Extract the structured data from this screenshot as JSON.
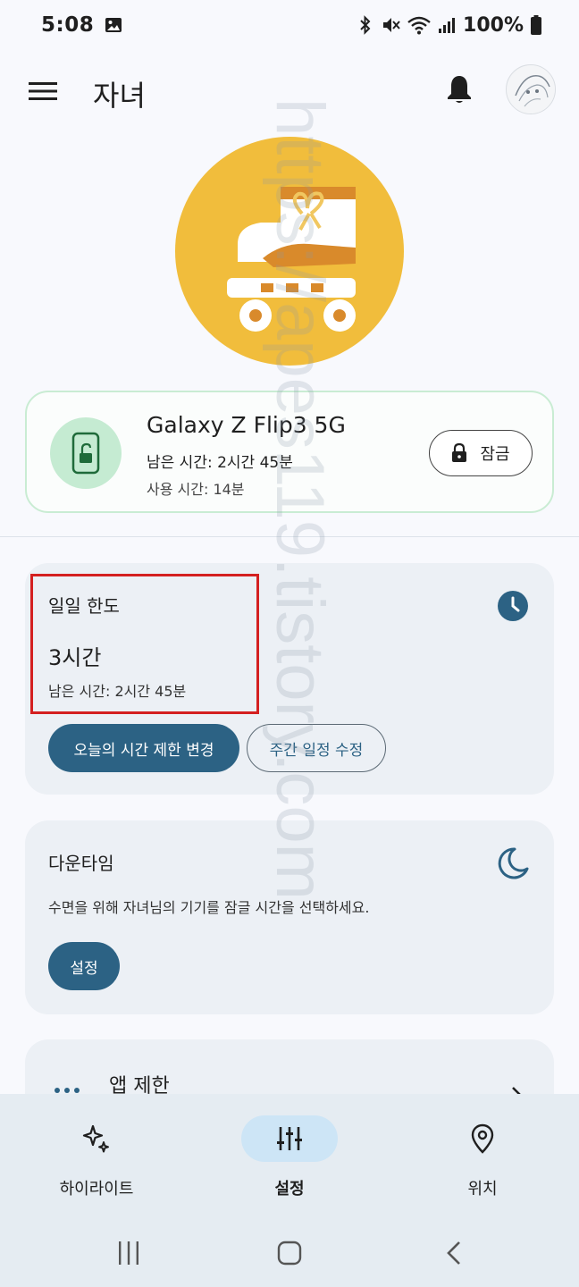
{
  "status_bar": {
    "time": "5:08",
    "battery": "100%"
  },
  "app_bar": {
    "title": "자녀"
  },
  "device": {
    "name": "Galaxy Z Flip3 5G",
    "remaining": "남은 시간: 2시간 45분",
    "used": "사용 시간: 14분",
    "lock_label": "잠금"
  },
  "daily_limit": {
    "title": "일일 한도",
    "value": "3시간",
    "remaining": "남은 시간: 2시간 45분",
    "change_today_label": "오늘의 시간 제한 변경",
    "edit_weekly_label": "주간 일정 수정"
  },
  "downtime": {
    "title": "다운타임",
    "description": "수면을 위해 자녀님의 기기를 잠글 시간을 선택하세요.",
    "setup_label": "설정"
  },
  "app_limits": {
    "title": "앱 제한"
  },
  "bottom_nav": {
    "items": [
      {
        "label": "하이라이트",
        "icon": "sparkle-icon"
      },
      {
        "label": "설정",
        "icon": "tune-icon",
        "active": true
      },
      {
        "label": "위치",
        "icon": "location-pin-icon"
      }
    ]
  },
  "watermark": "https://apes119.tistory.com",
  "colors": {
    "primary": "#2c6284",
    "hero_bg": "#f1bd3c",
    "device_accent": "#c5ebd2",
    "highlight": "#d42020"
  }
}
